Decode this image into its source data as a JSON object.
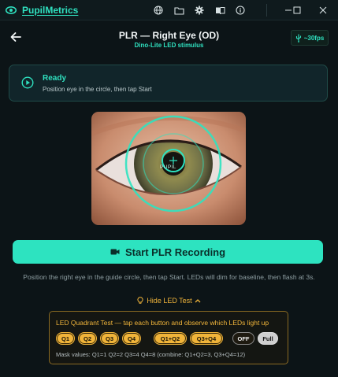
{
  "app": {
    "name": "PupilMetrics"
  },
  "titlebar": {
    "icons": [
      "globe-icon",
      "folder-icon",
      "gear-icon",
      "book-icon",
      "info-icon"
    ],
    "window_controls": [
      "minimize-icon",
      "maximize-icon",
      "close-icon"
    ]
  },
  "header": {
    "title": "PLR — Right Eye (OD)",
    "subtitle": "Dino-Lite LED stimulus",
    "fps": "~30fps"
  },
  "status": {
    "title": "Ready",
    "message": "Position eye in the circle, then tap Start"
  },
  "preview": {
    "overlay_label": "PUPIL"
  },
  "actions": {
    "start_label": "Start PLR Recording"
  },
  "instructions": "Position the right eye in the guide circle, then tap Start. LEDs will dim for baseline, then flash at 3s.",
  "led_toggle": {
    "label": "Hide LED Test"
  },
  "led_test": {
    "title": "LED Quadrant Test — tap each button and observe which LEDs light up",
    "buttons": [
      "Q1",
      "Q2",
      "Q3",
      "Q4",
      "Q1+Q2",
      "Q3+Q4",
      "OFF",
      "Full"
    ],
    "mask_values": "Mask values: Q1=1  Q2=2  Q3=4  Q4=8  (combine: Q1+Q2=3, Q3+Q4=12)"
  },
  "colors": {
    "accent": "#2de3c0",
    "background": "#0c1417",
    "led": "#f0b43a"
  }
}
